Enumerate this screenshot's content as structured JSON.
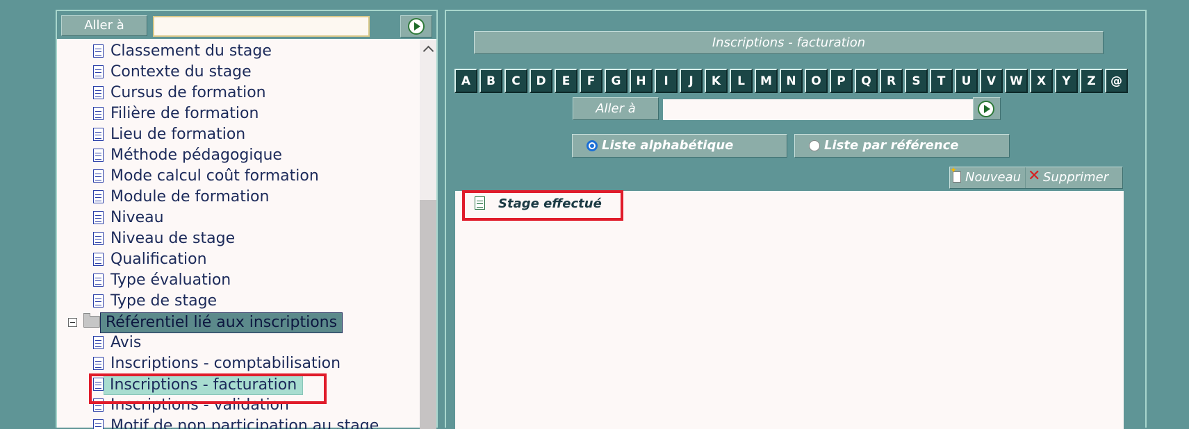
{
  "left_panel": {
    "goto_label": "Aller à",
    "goto_value": "",
    "tree_items": [
      "Classement du stage",
      "Contexte du stage",
      "Cursus de formation",
      "Filière de formation",
      "Lieu de formation",
      "Méthode pédagogique",
      "Mode calcul coût formation",
      "Module de formation",
      "Niveau",
      "Niveau de stage",
      "Qualification",
      "Type évaluation",
      "Type de stage"
    ],
    "folder": {
      "label": "Référentiel lié aux inscriptions",
      "children": [
        "Avis",
        "Inscriptions - comptabilisation",
        "Inscriptions - facturation",
        "Inscriptions - validation",
        "Motif de non participation au stage"
      ],
      "selected": "Inscriptions - facturation"
    }
  },
  "right_panel": {
    "title": "Inscriptions - facturation",
    "alphabet": [
      "A",
      "B",
      "C",
      "D",
      "E",
      "F",
      "G",
      "H",
      "I",
      "J",
      "K",
      "L",
      "M",
      "N",
      "O",
      "P",
      "Q",
      "R",
      "S",
      "T",
      "U",
      "V",
      "W",
      "X",
      "Y",
      "Z",
      "@"
    ],
    "goto_label": "Aller à",
    "goto_value": "",
    "radio_alpha": "Liste alphabétique",
    "radio_ref": "Liste par référence",
    "selected_radio": "Liste alphabétique",
    "new_label": "Nouveau",
    "delete_label": "Supprimer",
    "results": [
      "Stage effectué"
    ]
  },
  "colors": {
    "background": "#5f9596",
    "panel_border": "#a8d6cd",
    "highlight_frame": "#e01c2b",
    "selected_item": "#a8ddd0"
  }
}
